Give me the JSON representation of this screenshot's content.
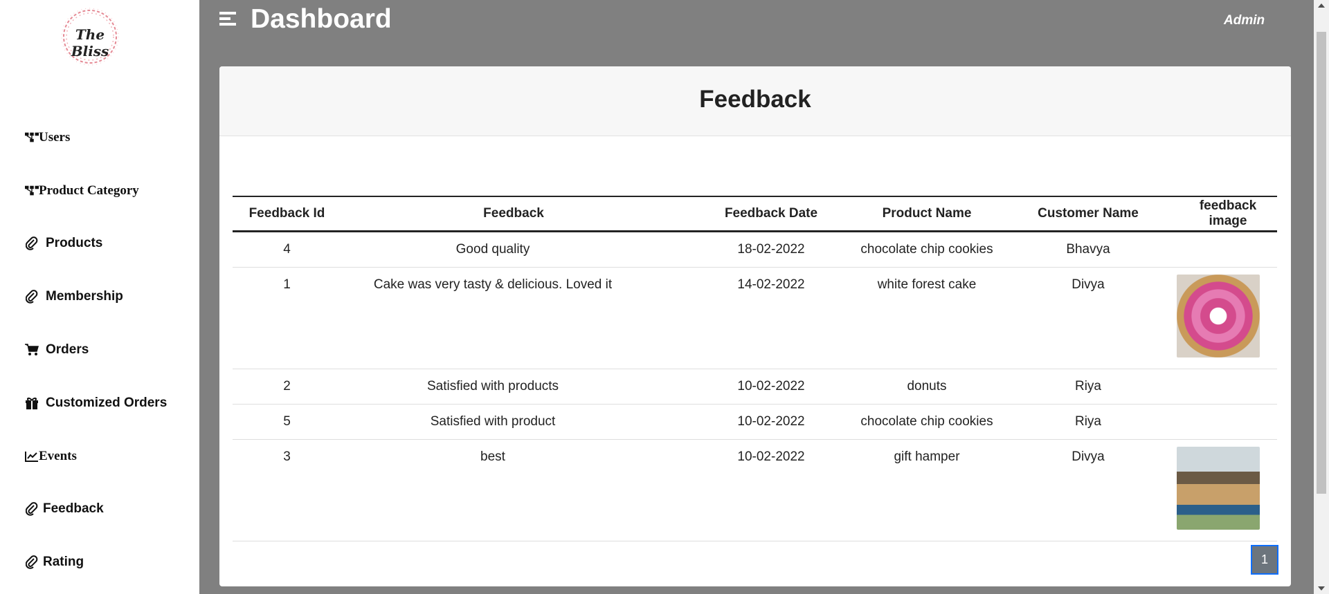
{
  "brand": {
    "logo_text": "The Bliss"
  },
  "header": {
    "title": "Dashboard",
    "user": "Admin"
  },
  "sidebar": {
    "items": [
      {
        "label": "Users",
        "icon": "sitemap-icon"
      },
      {
        "label": "Product Category",
        "icon": "sitemap-icon"
      },
      {
        "label": "Products",
        "icon": "paperclip-icon"
      },
      {
        "label": "Membership",
        "icon": "paperclip-icon"
      },
      {
        "label": "Orders",
        "icon": "cart-icon"
      },
      {
        "label": "Customized Orders",
        "icon": "gift-icon"
      },
      {
        "label": "Events",
        "icon": "chart-line-icon"
      },
      {
        "label": "Feedback",
        "icon": "paperclip-icon"
      },
      {
        "label": "Rating",
        "icon": "paperclip-icon"
      }
    ]
  },
  "card": {
    "title": "Feedback"
  },
  "table": {
    "headers": [
      "Feedback Id",
      "Feedback",
      "Feedback Date",
      "Product Name",
      "Customer Name",
      "feedback image"
    ],
    "rows": [
      {
        "id": "4",
        "feedback": "Good quality",
        "date": "18-02-2022",
        "product": "chocolate chip cookies",
        "customer": "Bhavya",
        "image": ""
      },
      {
        "id": "1",
        "feedback": "Cake was very tasty & delicious. Loved it",
        "date": "14-02-2022",
        "product": "white forest cake",
        "customer": "Divya",
        "image": "cake-photo"
      },
      {
        "id": "2",
        "feedback": "Satisfied with products",
        "date": "10-02-2022",
        "product": "donuts",
        "customer": "Riya",
        "image": ""
      },
      {
        "id": "5",
        "feedback": "Satisfied with product",
        "date": "10-02-2022",
        "product": "chocolate chip cookies",
        "customer": "Riya",
        "image": ""
      },
      {
        "id": "3",
        "feedback": "best",
        "date": "10-02-2022",
        "product": "gift hamper",
        "customer": "Divya",
        "image": "hamper-photo"
      }
    ]
  },
  "pagination": {
    "current": "1"
  },
  "colors": {
    "background": "#808080",
    "sidebar": "#ffffff",
    "page_button": "#6c757d",
    "logo_wreath": "#e58a95"
  }
}
